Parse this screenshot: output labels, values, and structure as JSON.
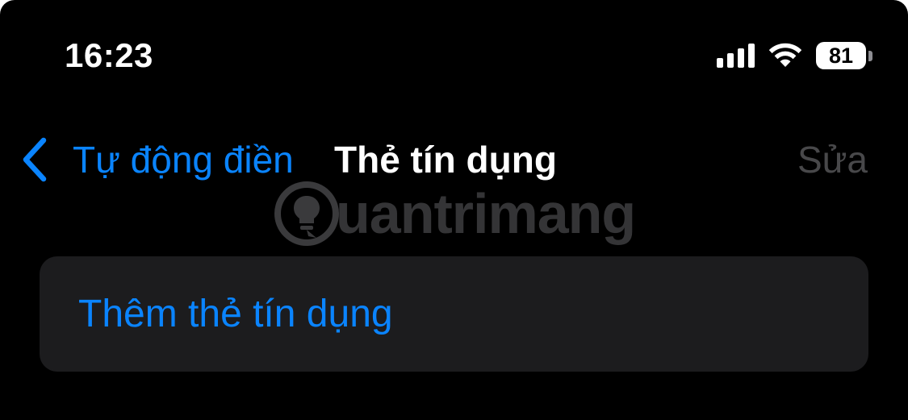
{
  "status_bar": {
    "time": "16:23",
    "battery_level": "81",
    "signal_icon": "cellular-signal-icon",
    "wifi_icon": "wifi-icon",
    "battery_icon": "battery-icon"
  },
  "nav": {
    "back_label": "Tự động điền",
    "back_icon": "chevron-left-icon",
    "title": "Thẻ tín dụng",
    "edit_label": "Sửa"
  },
  "watermark": {
    "text": "uantrimang",
    "icon": "lightbulb-logo-icon"
  },
  "list": {
    "add_card_label": "Thêm thẻ tín dụng"
  },
  "colors": {
    "background": "#000000",
    "accent": "#0a84ff",
    "card": "#1c1c1e",
    "disabled": "#48484a"
  }
}
